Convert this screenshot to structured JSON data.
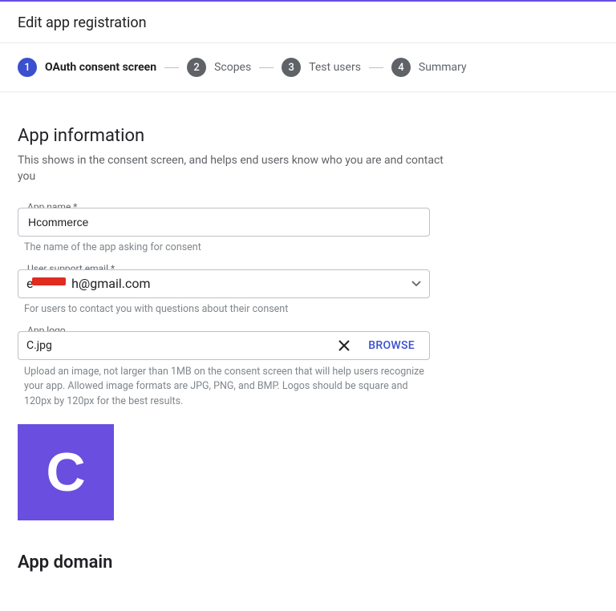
{
  "page": {
    "title": "Edit app registration"
  },
  "stepper": {
    "steps": [
      {
        "n": "1",
        "label": "OAuth consent screen",
        "active": true
      },
      {
        "n": "2",
        "label": "Scopes",
        "active": false
      },
      {
        "n": "3",
        "label": "Test users",
        "active": false
      },
      {
        "n": "4",
        "label": "Summary",
        "active": false
      }
    ]
  },
  "appInfo": {
    "heading": "App information",
    "sub": "This shows in the consent screen, and helps end users know who you are and contact you",
    "name": {
      "label": "App name *",
      "value": "Hcommerce",
      "helper": "The name of the app asking for consent"
    },
    "email": {
      "label": "User support email *",
      "value_prefix": "e",
      "value_suffix": "h@gmail.com",
      "helper": "For users to contact you with questions about their consent"
    },
    "logo": {
      "label": "App logo",
      "filename": "C.jpg",
      "browse": "BROWSE",
      "helper": "Upload an image, not larger than 1MB on the consent screen that will help users recognize your app. Allowed image formats are JPG, PNG, and BMP. Logos should be square and 120px by 120px for the best results.",
      "preview_letter": "C"
    }
  },
  "appDomain": {
    "heading": "App domain"
  }
}
